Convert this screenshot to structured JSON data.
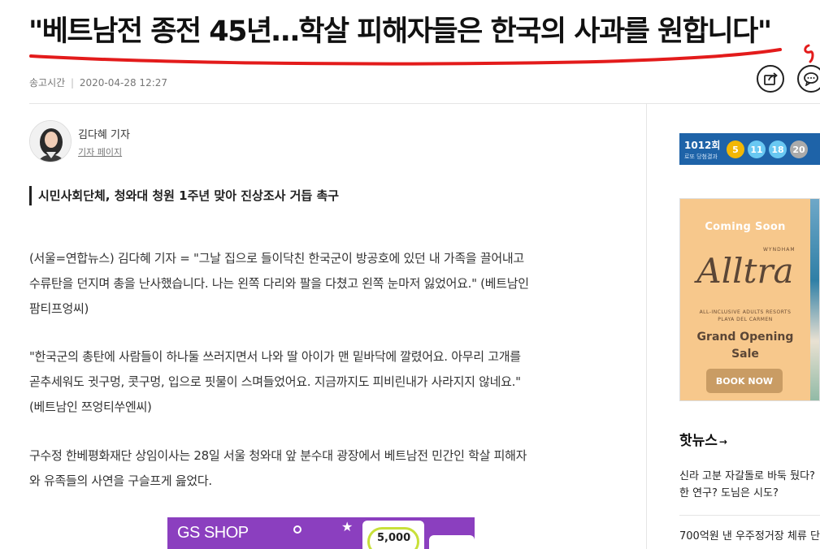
{
  "article": {
    "headline": "\"베트남전 종전 45년…학살 피해자들은 한국의 사과를 원합니다\"",
    "meta_label": "송고시간",
    "meta_sep": "|",
    "meta_time": "2020-04-28 12:27",
    "author_name": "김다혜 기자",
    "author_page": "기자 페이지",
    "subheadline": "시민사회단체, 청와대 청원 1주년 맞아 진상조사 거듭 촉구",
    "paragraphs": [
      {
        "lines": [
          "(서울=연합뉴스) 김다혜 기자 = \"그날 집으로 들이닥친 한국군이 방공호에 있던 내 가족을 끌어내고",
          "수류탄을 던지며 총을 난사했습니다. 나는 왼쪽 다리와 팔을 다쳤고 왼쪽 눈마저 잃었어요.\" (베트남인",
          "팜티프엉씨)"
        ]
      },
      {
        "lines": [
          "\"한국군의 총탄에 사람들이 하나둘 쓰러지면서 나와 딸 아이가 맨 밑바닥에 깔렸어요. 아무리 고개를",
          "곧추세워도 귓구멍, 콧구멍, 입으로 핏물이 스며들었어요. 지금까지도 피비린내가 사라지지 않네요.\"",
          "(베트남인 쯔엉티쑤엔씨)"
        ]
      },
      {
        "lines": [
          "구수정 한베평화재단 상임이사는 28일 서울 청와대 앞 분수대 광장에서 베트남전 민간인 학살 피해자",
          "와 유족들의 사연을 구슬프게 읊었다."
        ]
      }
    ]
  },
  "toolbar": {
    "share_icon": "share-icon",
    "comment_icon": "comment-icon"
  },
  "ads": {
    "gs_shop": {
      "brand": "GS SHOP",
      "coupon": "5,000"
    },
    "hotel": {
      "coming_soon": "Coming Soon",
      "wyndham": "WYNDHAM",
      "brand": "Alltra",
      "tagline_1": "ALL-INCLUSIVE ADULTS RESORTS",
      "tagline_2": "PLAYA DEL CARMEN",
      "grand_opening_1": "Grand Opening",
      "grand_opening_2": "Sale",
      "cta": "BOOK NOW"
    }
  },
  "lotto": {
    "round": "1012회",
    "subtitle": "로또 당첨결과",
    "numbers": [
      "5",
      "11",
      "18",
      "20"
    ],
    "ball_colors": [
      "#f2b705",
      "#69c8f2",
      "#69c8f2",
      "#aaaaaa"
    ]
  },
  "hot_news": {
    "title": "핫뉴스",
    "arrow": "→",
    "items": [
      {
        "line1": "신라 고분 자갈돌로 바둑 뒀다?",
        "line2": "한 연구? 도님은 시도?"
      },
      {
        "line1": "700억원 낸 우주정거장 체류 단",
        "line2": ""
      }
    ]
  },
  "colors": {
    "headline_underline": "#e31b1b",
    "lotto_bg": "#1e63a8",
    "gs_shop_bg": "#8b3fbf",
    "hotel_bg": "#f7c88c"
  }
}
